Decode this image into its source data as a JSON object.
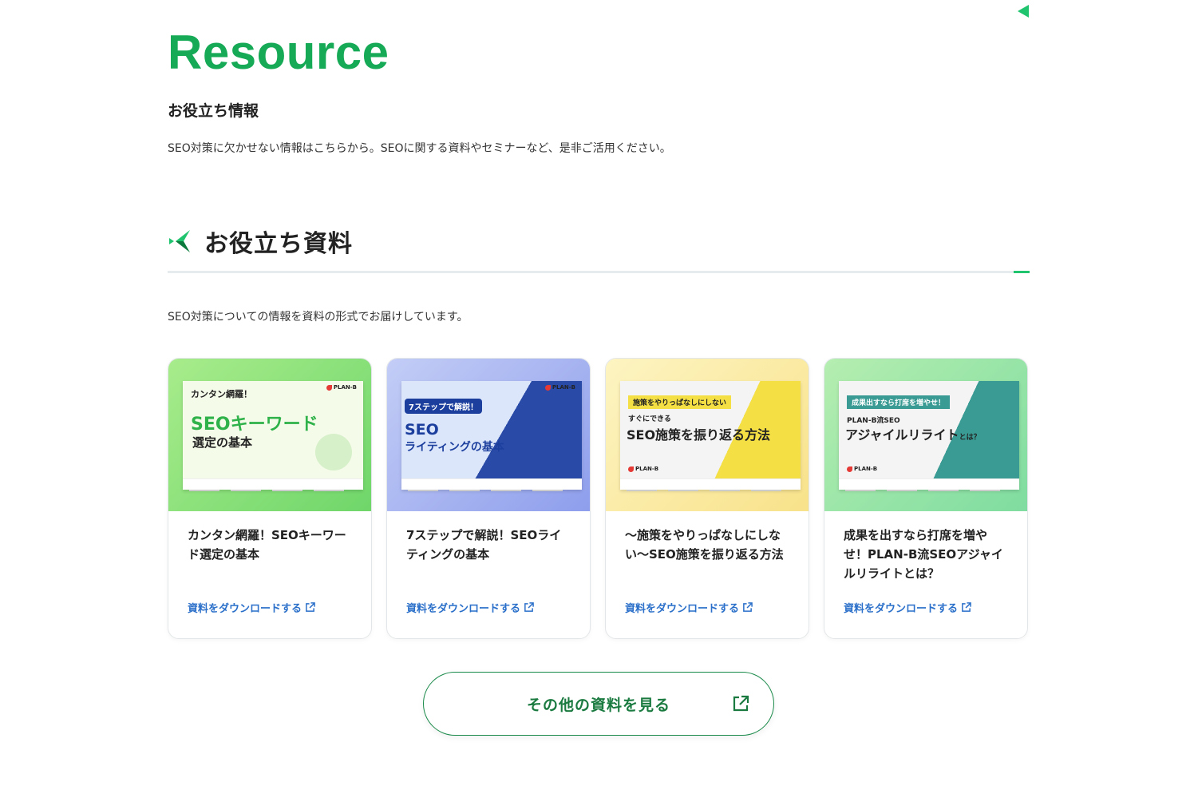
{
  "resource": {
    "title": "Resource",
    "subtitle": "お役立ち情報",
    "description": "SEO対策に欠かせない情報はこちらから。SEOに関する資料やセミナーなど、是非ご活用ください。"
  },
  "section": {
    "title": "お役立ち資料",
    "description": "SEO対策についての情報を資料の形式でお届けしています。"
  },
  "cards": [
    {
      "title": "カンタン網羅！SEOキーワード選定の基本",
      "link": "資料をダウンロードする",
      "thumb": {
        "tag": "カンタン網羅！",
        "main": "SEOキーワード",
        "sub": "選定の基本",
        "brand": "PLAN-B"
      }
    },
    {
      "title": "7ステップで解説！SEOライティングの基本",
      "link": "資料をダウンロードする",
      "thumb": {
        "tag": "7ステップで解説！",
        "main": "SEO",
        "sub": "ライティングの基本",
        "brand": "PLAN-B"
      }
    },
    {
      "title": "〜施策をやりっぱなしにしない〜SEO施策を振り返る方法",
      "link": "資料をダウンロードする",
      "thumb": {
        "tag": "施策をやりっぱなしにしない",
        "pre": "すぐにできる",
        "main": "SEO施策を振り返る方法",
        "brand": "PLAN-B"
      }
    },
    {
      "title": "成果を出すなら打席を増やせ！PLAN-B流SEOアジャイルリライトとは？",
      "link": "資料をダウンロードする",
      "thumb": {
        "tag": "成果出すなら打席を増やせ！",
        "pre": "PLAN-B流SEO",
        "main": "アジャイルリライト",
        "suffix": "とは？",
        "brand": "PLAN-B"
      }
    }
  ],
  "more_button": {
    "label": "その他の資料を見る"
  },
  "colors": {
    "brand_green": "#16a956",
    "link_blue": "#2a6fc9",
    "button_green": "#1a7a40"
  }
}
